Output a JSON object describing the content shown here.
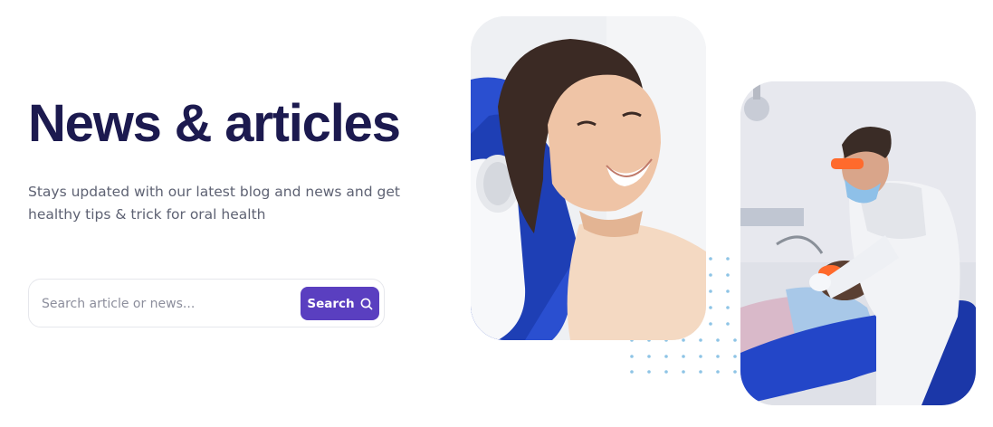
{
  "hero": {
    "title": "News & articles",
    "subtitle": "Stays updated with our latest blog and news and get healthy tips & trick for oral health"
  },
  "search": {
    "placeholder": "Search article or news...",
    "value": "",
    "button_label": "Search",
    "button_icon": "search-icon"
  },
  "images": {
    "patient": {
      "icon": "patient-smiling-photo"
    },
    "dentist": {
      "icon": "dentist-treating-patient-photo"
    }
  },
  "colors": {
    "title": "#1c1a4f",
    "subtitle": "#5e6273",
    "accent": "#5a3fc0",
    "dots": "#8ec4e6",
    "chair_blue": "#2a4fd0"
  }
}
